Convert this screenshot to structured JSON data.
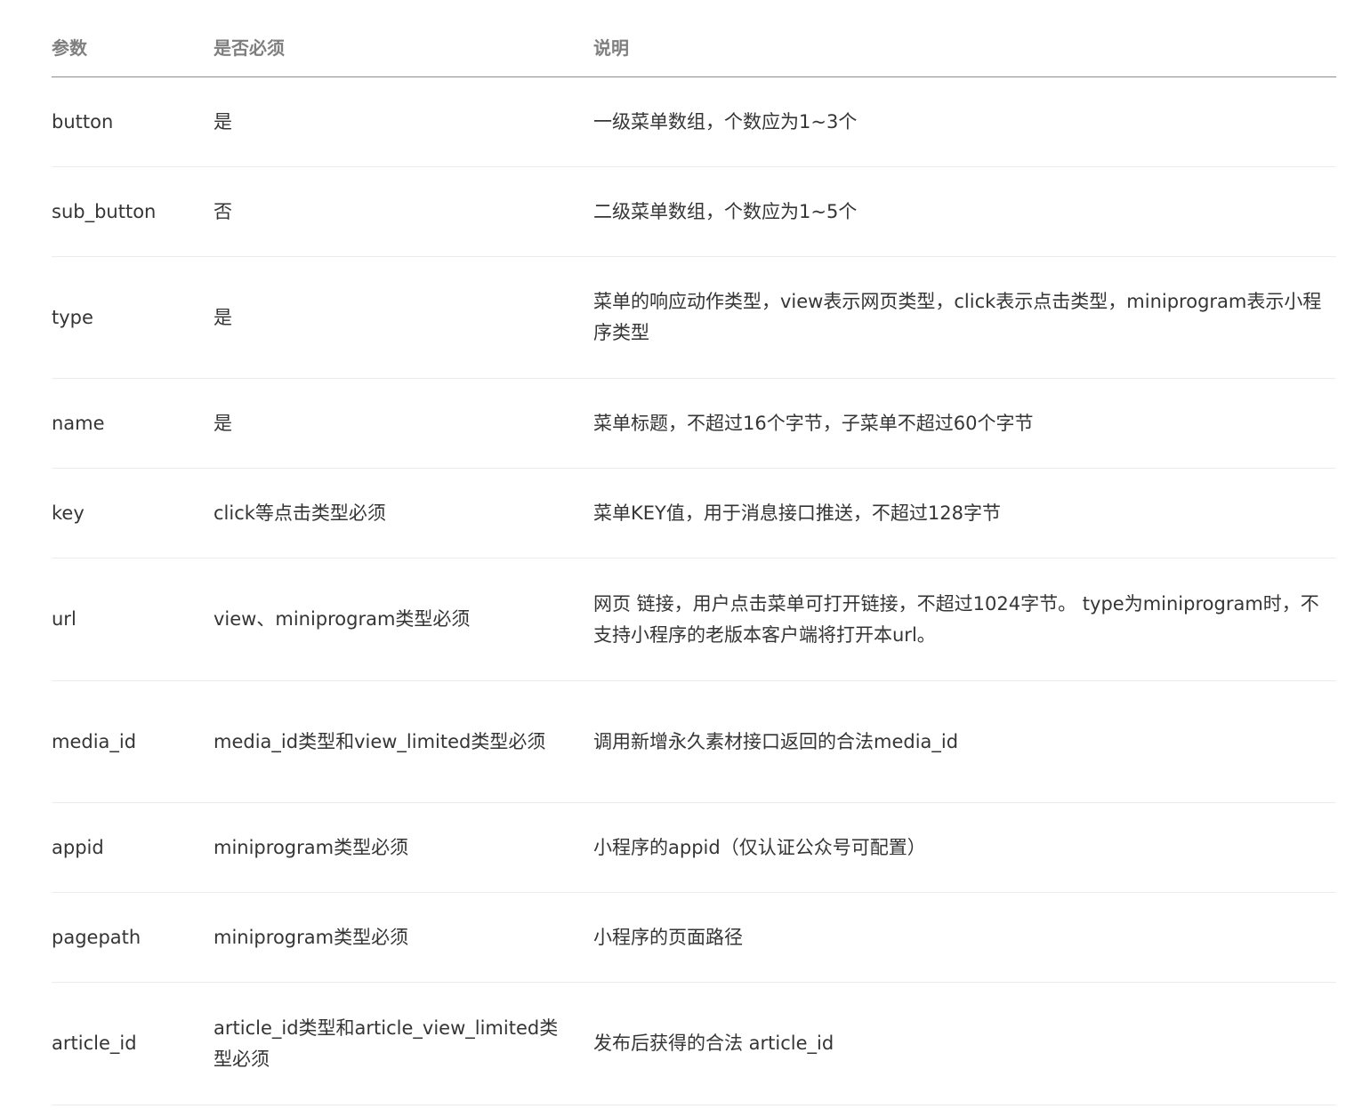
{
  "headers": {
    "param": "参数",
    "required": "是否必须",
    "desc": "说明"
  },
  "rows": [
    {
      "param": "button",
      "required": "是",
      "desc": "一级菜单数组，个数应为1~3个"
    },
    {
      "param": "sub_button",
      "required": "否",
      "desc": "二级菜单数组，个数应为1~5个"
    },
    {
      "param": "type",
      "required": "是",
      "desc": "菜单的响应动作类型，view表示网页类型，click表示点击类型，miniprogram表示小程序类型"
    },
    {
      "param": "name",
      "required": "是",
      "desc": "菜单标题，不超过16个字节，子菜单不超过60个字节"
    },
    {
      "param": "key",
      "required": "click等点击类型必须",
      "desc": "菜单KEY值，用于消息接口推送，不超过128字节"
    },
    {
      "param": "url",
      "required": "view、miniprogram类型必须",
      "desc": "网页 链接，用户点击菜单可打开链接，不超过1024字节。 type为miniprogram时，不支持小程序的老版本客户端将打开本url。"
    },
    {
      "param": "media_id",
      "required": "media_id类型和view_limited类型必须",
      "desc": "调用新增永久素材接口返回的合法media_id"
    },
    {
      "param": "appid",
      "required": "miniprogram类型必须",
      "desc": "小程序的appid（仅认证公众号可配置）"
    },
    {
      "param": "pagepath",
      "required": "miniprogram类型必须",
      "desc": "小程序的页面路径"
    },
    {
      "param": "article_id",
      "required": "article_id类型和article_view_limited类型必须",
      "desc": "发布后获得的合法 article_id"
    }
  ]
}
